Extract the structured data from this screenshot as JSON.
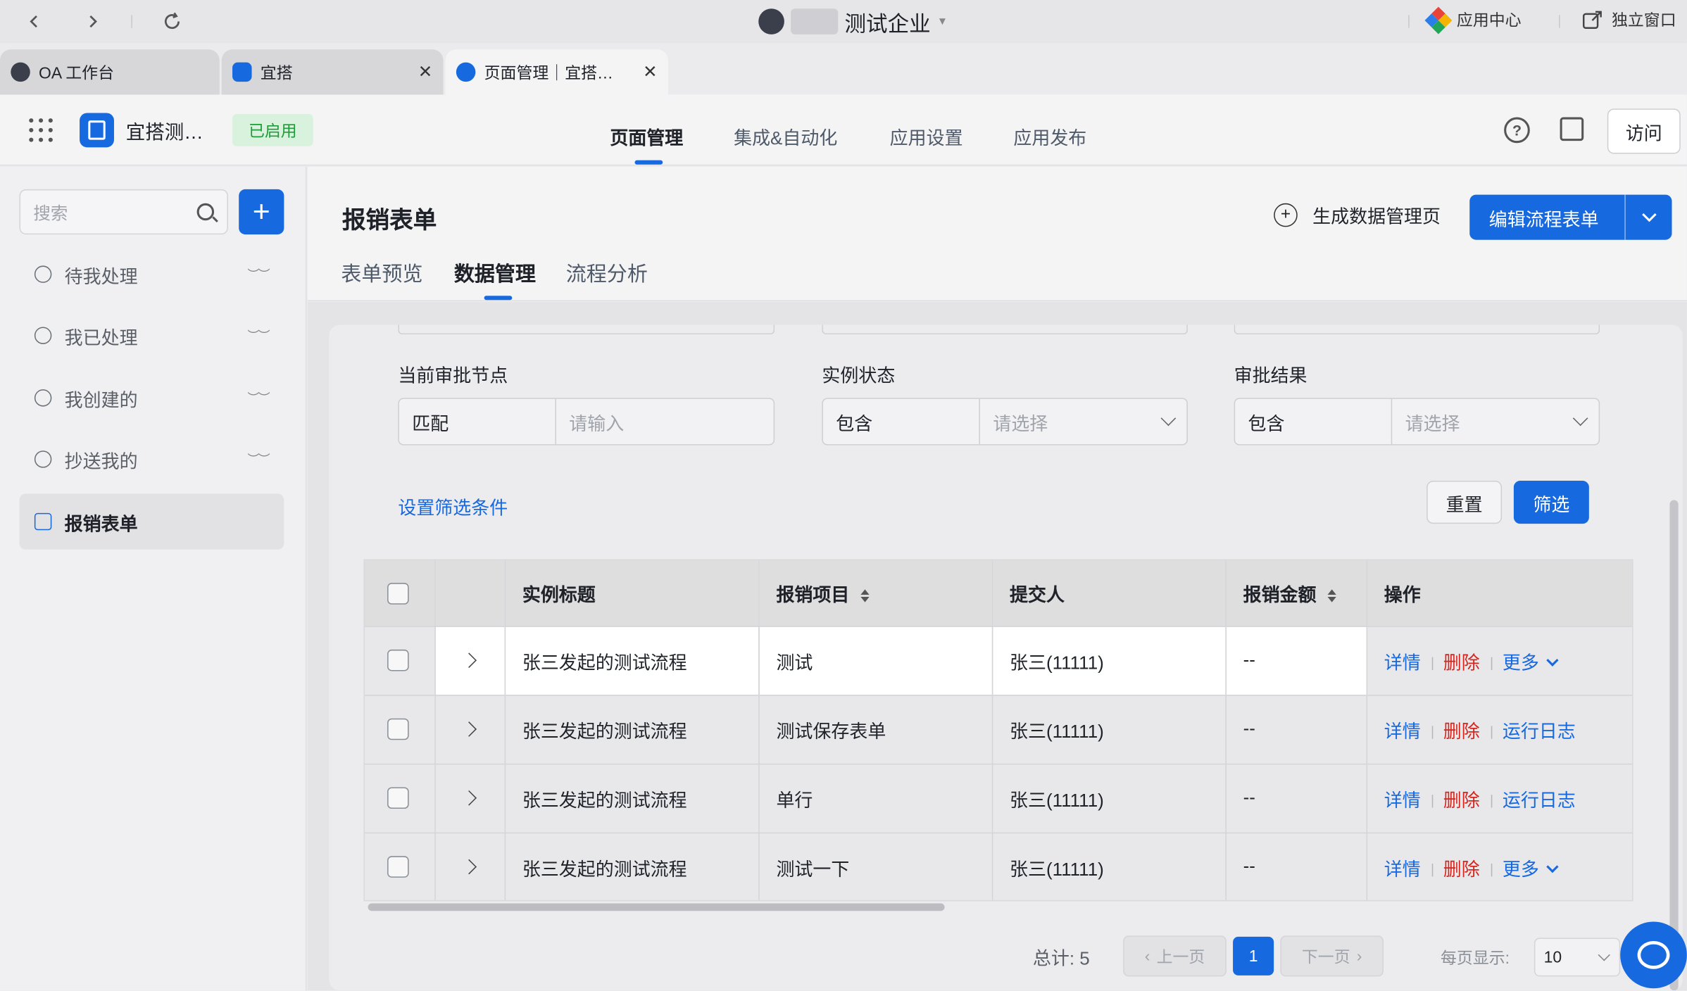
{
  "browser": {
    "company_name": "测试企业",
    "app_center": "应用中心",
    "standalone_window": "独立窗口",
    "tabs": [
      {
        "label": "OA 工作台"
      },
      {
        "label": "宜搭"
      },
      {
        "label": "页面管理｜宜搭…"
      }
    ]
  },
  "app_header": {
    "app_name": "宜搭测…",
    "status_badge": "已启用",
    "tabs": [
      {
        "label": "页面管理"
      },
      {
        "label": "集成&自动化"
      },
      {
        "label": "应用设置"
      },
      {
        "label": "应用发布"
      }
    ],
    "help_glyph": "?",
    "visit_label": "访问"
  },
  "sidebar": {
    "search_placeholder": "搜索",
    "add_glyph": "+",
    "items": [
      {
        "label": "待我处理",
        "icon": "clock-icon"
      },
      {
        "label": "我已处理",
        "icon": "user-check-icon"
      },
      {
        "label": "我创建的",
        "icon": "user-add-icon"
      },
      {
        "label": "抄送我的",
        "icon": "send-icon"
      },
      {
        "label": "报销表单",
        "icon": "org-chart-icon"
      }
    ],
    "eye_glyph": "︶︶"
  },
  "page": {
    "title": "报销表单",
    "generate_label": "生成数据管理页",
    "edit_label": "编辑流程表单",
    "subtabs": [
      {
        "label": "表单预览"
      },
      {
        "label": "数据管理"
      },
      {
        "label": "流程分析"
      }
    ]
  },
  "filters": {
    "fields": [
      {
        "label": "当前审批节点",
        "operator": "匹配",
        "placeholder": "请输入"
      },
      {
        "label": "实例状态",
        "operator": "包含",
        "placeholder": "请选择"
      },
      {
        "label": "审批结果",
        "operator": "包含",
        "placeholder": "请选择"
      }
    ],
    "set_conditions": "设置筛选条件",
    "reset": "重置",
    "filter": "筛选"
  },
  "table": {
    "columns": [
      "实例标题",
      "报销项目",
      "提交人",
      "报销金额",
      "操作"
    ],
    "rows": [
      {
        "title": "张三发起的测试流程",
        "project": "测试",
        "submitter": "张三(11111)",
        "amount": "--",
        "actions": [
          "详情",
          "删除",
          "更多"
        ]
      },
      {
        "title": "张三发起的测试流程",
        "project": "测试保存表单",
        "submitter": "张三(11111)",
        "amount": "--",
        "actions": [
          "详情",
          "删除",
          "运行日志"
        ]
      },
      {
        "title": "张三发起的测试流程",
        "project": "单行",
        "submitter": "张三(11111)",
        "amount": "--",
        "actions": [
          "详情",
          "删除",
          "运行日志"
        ]
      },
      {
        "title": "张三发起的测试流程",
        "project": "测试一下",
        "submitter": "张三(11111)",
        "amount": "--",
        "actions": [
          "详情",
          "删除",
          "更多"
        ]
      }
    ]
  },
  "pagination": {
    "total": "总计: 5",
    "prev": "上一页",
    "current": "1",
    "next": "下一页",
    "page_size_label": "每页显示:",
    "page_size": "10"
  },
  "colors": {
    "primary": "#1769e0",
    "danger": "#d6251c",
    "success_bg": "#d9f2dd",
    "success_text": "#1f9c3a"
  }
}
